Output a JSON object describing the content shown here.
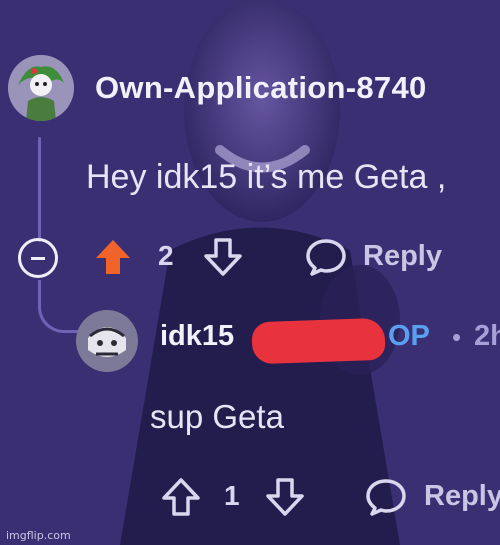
{
  "colors": {
    "background": "#3b2f74",
    "upvote_active": "#f0642a",
    "op_badge": "#5aa0f0",
    "redaction": "#e8333f"
  },
  "comment_1": {
    "username": "Own-Application-8740",
    "text": "Hey idk15 it’s me Geta ,",
    "vote_count": "2",
    "upvoted": true,
    "reply_label": "Reply"
  },
  "comment_2": {
    "username": "idk15",
    "op_badge": "OP",
    "separator": "•",
    "time": "2h",
    "text": "sup Geta",
    "vote_count": "1",
    "reply_label": "Reply"
  },
  "watermark": "imgflip.com"
}
